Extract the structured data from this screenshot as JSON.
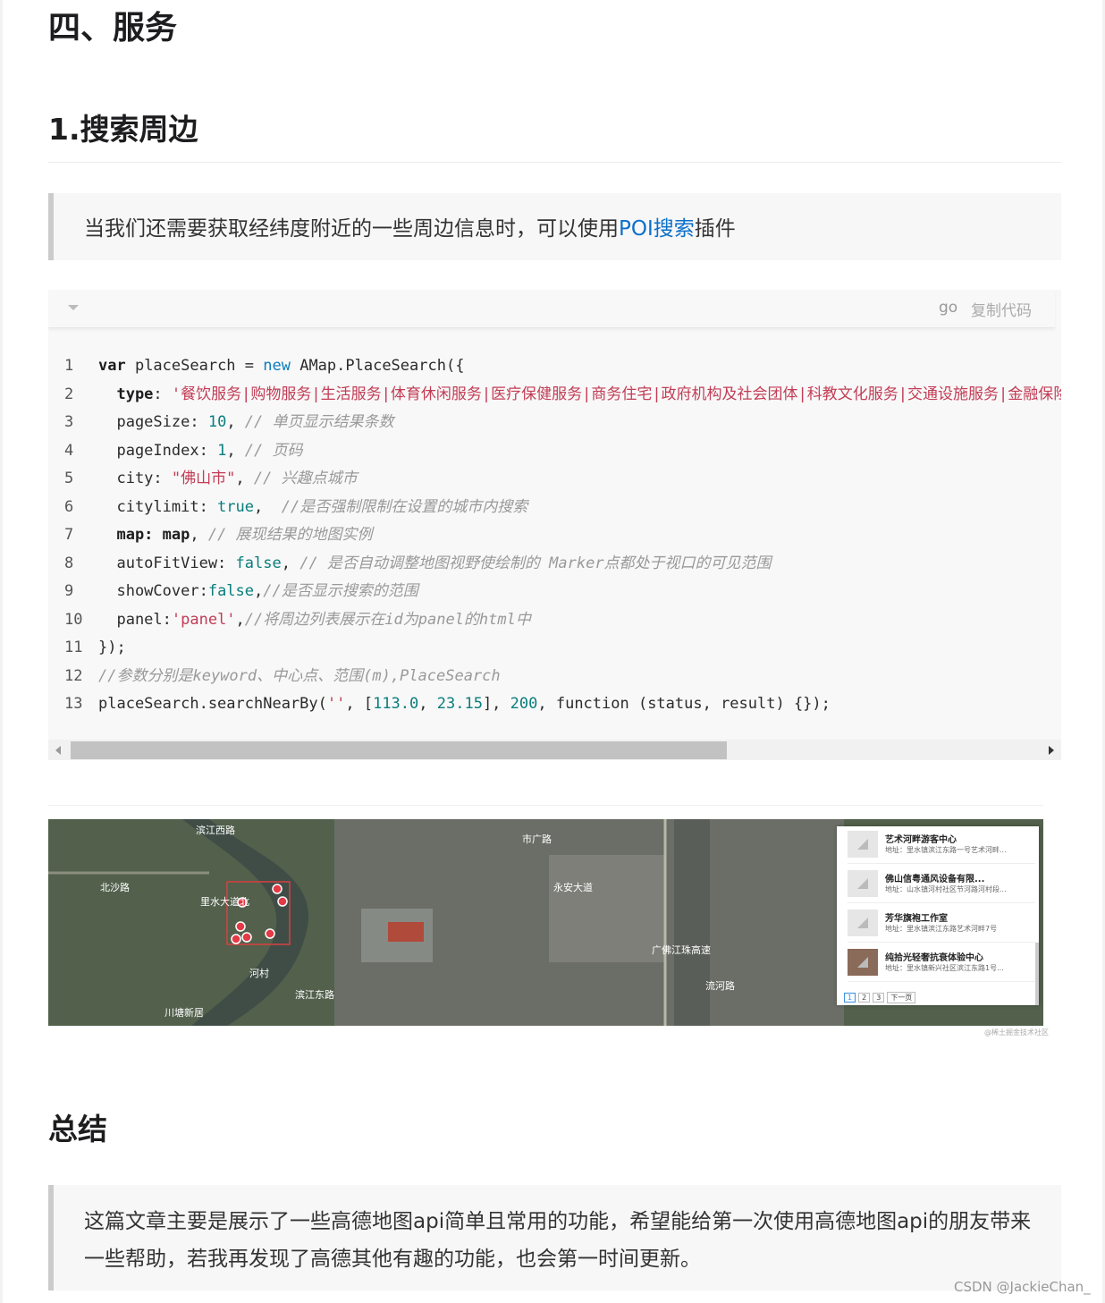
{
  "section_title": "四、服务",
  "subsection_title": "1.搜索周边",
  "intro_quote": {
    "text_before": "当我们还需要获取经纬度附近的一些周边信息时，可以使用",
    "link_text": "POI搜索",
    "text_after": "插件"
  },
  "code_block": {
    "language": "go",
    "copy_label": "复制代码",
    "lines": [
      {
        "n": "1"
      },
      {
        "n": "2"
      },
      {
        "n": "3"
      },
      {
        "n": "4"
      },
      {
        "n": "5"
      },
      {
        "n": "6"
      },
      {
        "n": "7"
      },
      {
        "n": "8"
      },
      {
        "n": "9"
      },
      {
        "n": "10"
      },
      {
        "n": "11"
      },
      {
        "n": "12"
      },
      {
        "n": "13"
      }
    ],
    "tokens": {
      "l1_a": "var",
      "l1_b": " placeSearch = ",
      "l1_c": "new",
      "l1_d": " AMap.PlaceSearch({",
      "l2_a": "  type",
      "l2_b": ": ",
      "l2_c": "'餐饮服务|购物服务|生活服务|体育休闲服务|医疗保健服务|商务住宅|政府机构及社会团体|科教文化服务|交通设施服务|金融保险服务",
      "l3_a": "  pageSize: ",
      "l3_b": "10",
      "l3_c": ", ",
      "l3_d": "// 单页显示结果条数",
      "l4_a": "  pageIndex: ",
      "l4_b": "1",
      "l4_c": ", ",
      "l4_d": "// 页码",
      "l5_a": "  city: ",
      "l5_b": "\"佛山市\"",
      "l5_c": ", ",
      "l5_d": "// 兴趣点城市",
      "l6_a": "  citylimit: ",
      "l6_b": "true",
      "l6_c": ",  ",
      "l6_d": "//是否强制限制在设置的城市内搜索",
      "l7_a": "  map: map",
      "l7_b": ", ",
      "l7_c": "// 展现结果的地图实例",
      "l8_a": "  autoFitView: ",
      "l8_b": "false",
      "l8_c": ", ",
      "l8_d": "// 是否自动调整地图视野使绘制的 Marker点都处于视口的可见范围",
      "l9_a": "  showCover:",
      "l9_b": "false",
      "l9_c": ",",
      "l9_d": "//是否显示搜索的范围",
      "l10_a": "  panel:",
      "l10_b": "'panel'",
      "l10_c": ",",
      "l10_d": "//将周边列表展示在id为panel的html中",
      "l11_a": "});",
      "l12_a": "//参数分别是keyword、中心点、范围(m),PlaceSearch",
      "l13_a": "placeSearch.searchNearBy(",
      "l13_b": "''",
      "l13_c": ", [",
      "l13_d": "113.0",
      "l13_e": ", ",
      "l13_f": "23.15",
      "l13_g": "], ",
      "l13_h": "200",
      "l13_i": ", function (status, result) {});"
    }
  },
  "map_panel": {
    "items": [
      {
        "title": "艺术河畔游客中心",
        "address": "地址：里水镇滨江东路一号艺术河畔..."
      },
      {
        "title": "佛山信粤通风设备有限...",
        "address": "地址：山水镇河村社区节河路河村段..."
      },
      {
        "title": "芳华旗袍工作室",
        "address": "地址：里水镇滨江东路艺术河畔7号"
      },
      {
        "title": "纯拾光轻奢抗衰体验中心",
        "address": "地址：里水镇新兴社区滨江东路1号..."
      }
    ],
    "pages": [
      "1",
      "2",
      "3"
    ],
    "next_label": "下一页"
  },
  "map_credit": "@稀土掘金技术社区",
  "map_labels": [
    "滨江西路",
    "北沙路",
    "里水大道北",
    "河村",
    "滨江东路",
    "市广路",
    "永安大道",
    "广佛江珠高速",
    "流河路",
    "川塘新居"
  ],
  "summary_title": "总结",
  "summary_text": "这篇文章主要是展示了一些高德地图api简单且常用的功能，希望能给第一次使用高德地图api的朋友带来一些帮助，若我再发现了高德其他有趣的功能，也会第一时间更新。",
  "watermark": "CSDN @JackieChan_",
  "colors": {
    "link": "#0b6fcb",
    "code_string": "#c23c55",
    "code_number": "#0a7d7d",
    "code_comment": "#999999",
    "quote_border": "#cbcbcb"
  }
}
